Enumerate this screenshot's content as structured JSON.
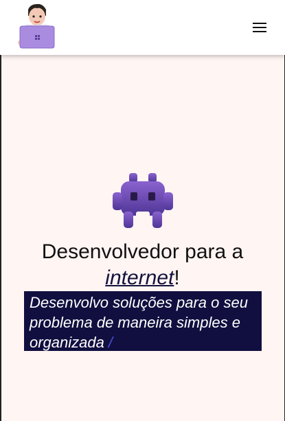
{
  "header": {
    "logo_icon": "developer-avatar-with-laptop",
    "menu_icon": "hamburger-menu"
  },
  "hero": {
    "icon": "alien-monster",
    "title_prefix": "Desenvolvedor para a ",
    "title_highlight": "internet",
    "title_suffix": "!",
    "subtitle": "Desenvolvo soluções para o seu problema de maneira simples e organizada",
    "cursor": "/"
  },
  "colors": {
    "background": "#fff5f3",
    "header": "#ffffff",
    "subtitle_bg": "#110f3f",
    "monster": "#6b4bb3",
    "cursor": "#4a4fd8"
  }
}
